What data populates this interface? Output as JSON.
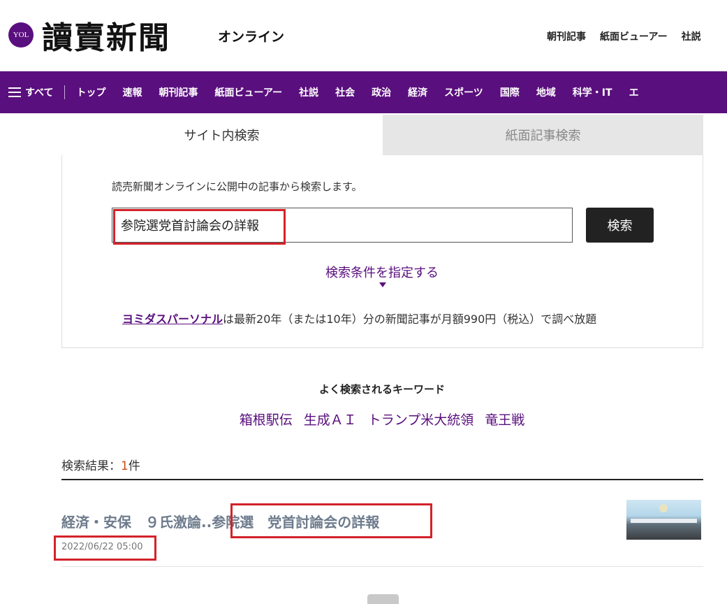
{
  "header": {
    "logo_badge": "YOL",
    "logo_text": "讀賣新聞",
    "logo_sub": "オンライン",
    "top_links": [
      "朝刊記事",
      "紙面ビューアー",
      "社説"
    ]
  },
  "nav": {
    "all_label": "すべて",
    "items": [
      "トップ",
      "速報",
      "朝刊記事",
      "紙面ビューアー",
      "社説",
      "社会",
      "政治",
      "経済",
      "スポーツ",
      "国際",
      "地域",
      "科学・IT",
      "エ"
    ]
  },
  "search": {
    "tabs": [
      "サイト内検索",
      "紙面記事検索"
    ],
    "description": "読売新聞オンラインに公開中の記事から検索します。",
    "query": "参院選党首討論会の詳報",
    "button": "検索",
    "conditions_link": "検索条件を指定する",
    "promo_link": "ヨミダスパーソナル",
    "promo_text": "は最新20年（または10年）分の新聞記事が月額990円（税込）で調べ放題"
  },
  "keywords": {
    "title": "よく検索されるキーワード",
    "items": [
      "箱根駅伝",
      "生成ＡＩ",
      "トランプ米大統領",
      "竜王戦"
    ]
  },
  "results": {
    "label": "検索結果：",
    "count": "1",
    "unit": "件",
    "items": [
      {
        "title_prefix": "経済・安保　９氏激論..",
        "title_highlight": "参院選　党首討論会の詳報",
        "date": "2022/06/22 05:00"
      }
    ]
  },
  "colors": {
    "brand": "#5a0f7e",
    "highlight_box": "#d3222a",
    "count_accent": "#c44b1c"
  }
}
